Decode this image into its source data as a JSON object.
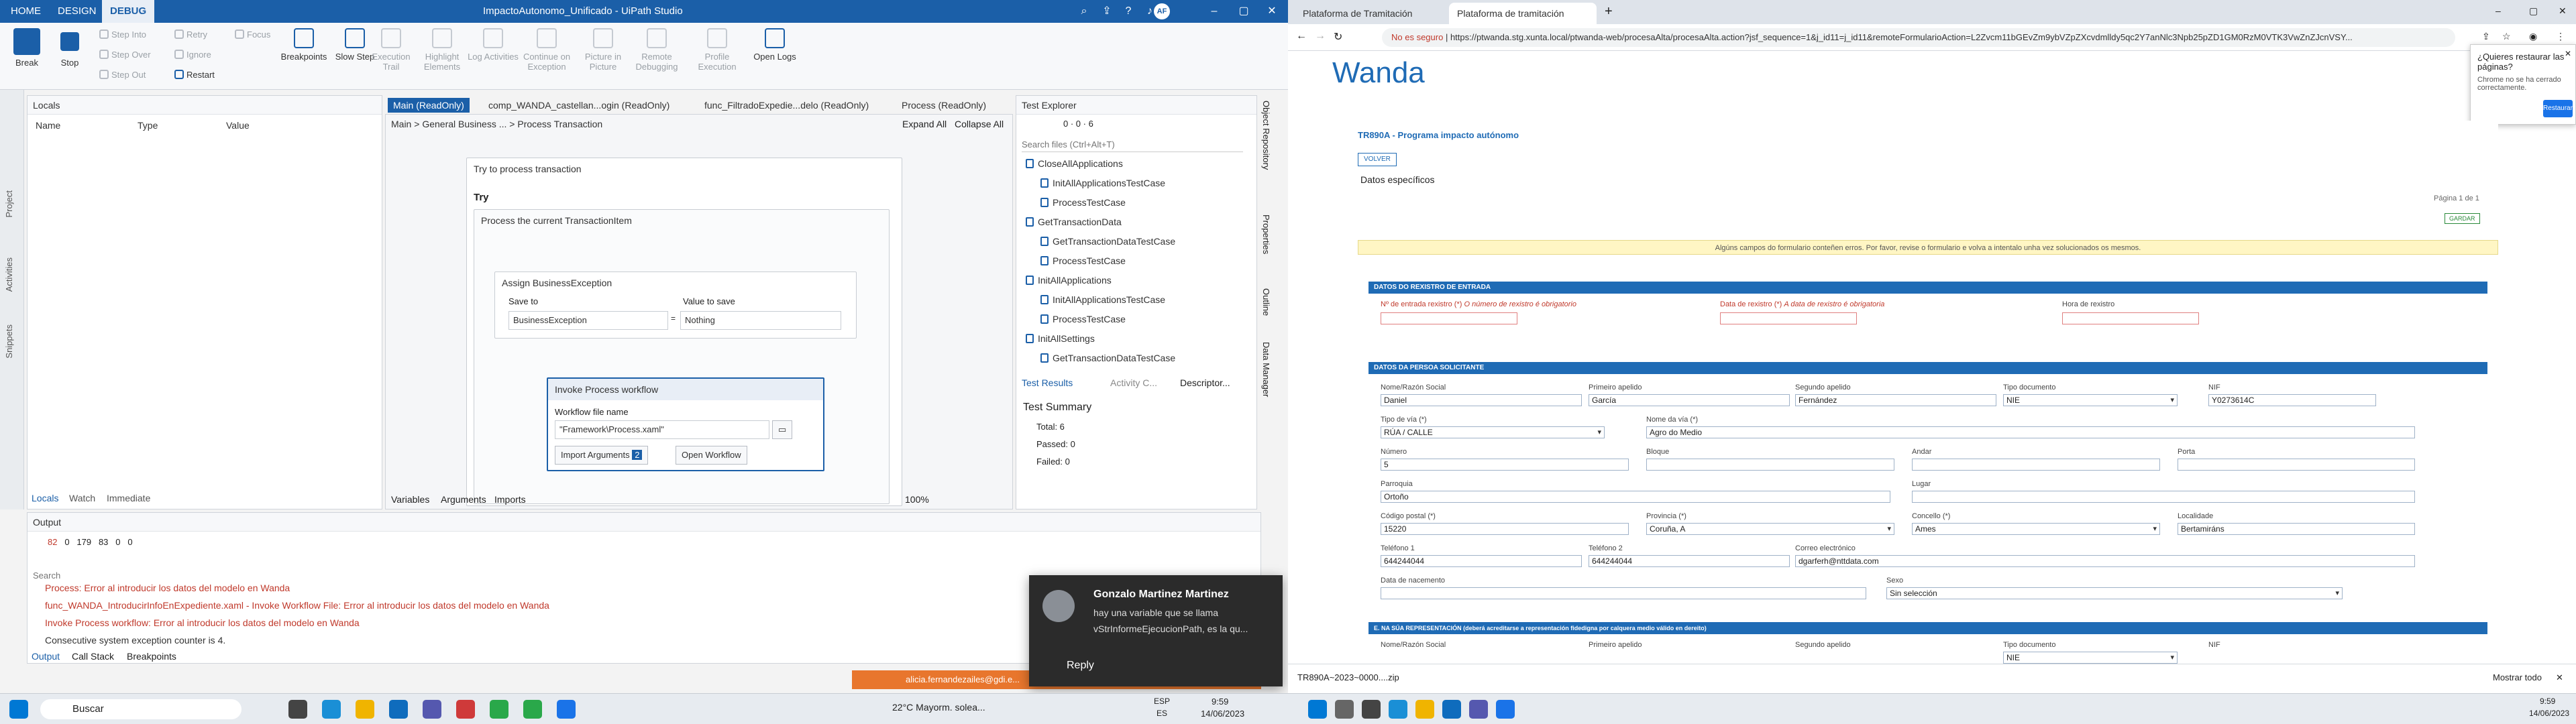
{
  "studio": {
    "tabs": [
      "HOME",
      "DESIGN",
      "DEBUG"
    ],
    "active_tab": "DEBUG",
    "title": "ImpactoAutonomo_Unificado - UiPath Studio",
    "user_initials": "AF",
    "ribbon": {
      "break": "Break",
      "stop": "Stop",
      "step_into": "Step Into",
      "step_over": "Step Over",
      "step_out": "Step Out",
      "retry": "Retry",
      "ignore": "Ignore",
      "restart": "Restart",
      "focus": "Focus",
      "breakpoints": "Breakpoints",
      "slow_step": "Slow Step",
      "execution_trail": "Execution Trail",
      "highlight_elements": "Highlight Elements",
      "log_activities": "Log Activities",
      "continue_on_exception": "Continue on Exception",
      "picture_in_picture": "Picture in Picture",
      "remote_debugging": "Remote Debugging",
      "profile_execution": "Profile Execution",
      "open_logs": "Open Logs"
    },
    "side_tabs": [
      "Project",
      "Activities",
      "Snippets"
    ],
    "locals": {
      "title": "Locals",
      "cols": [
        "Name",
        "Type",
        "Value"
      ],
      "bottom_tabs": [
        "Locals",
        "Watch",
        "Immediate"
      ]
    },
    "doc_tabs": [
      "Main (ReadOnly)",
      "comp_WANDA_castellan...ogin (ReadOnly)",
      "func_FiltradoExpedie...delo (ReadOnly)",
      "Process (ReadOnly)"
    ],
    "breadcrumb": [
      "Main",
      "General Business ...",
      "Process Transaction"
    ],
    "expand_all": "Expand All",
    "collapse_all": "Collapse All",
    "activities": {
      "try_process": "Try to process transaction",
      "try": "Try",
      "process_current": "Process the current TransactionItem",
      "assign": "Assign BusinessException",
      "save_to": "Save to",
      "value_to_save": "Value to save",
      "save_to_val": "BusinessException",
      "value_val": "Nothing",
      "invoke": "Invoke Process workflow",
      "wf_file_name": "Workflow file name",
      "wf_file_val": "\"Framework\\Process.xaml\"",
      "import_args": "Import Arguments",
      "import_count": "2",
      "open_workflow": "Open Workflow"
    },
    "designer_bottom": [
      "Variables",
      "Arguments",
      "Imports"
    ],
    "zoom": "100%",
    "test_explorer": {
      "title": "Test Explorer",
      "counts": [
        "0",
        "0",
        "6"
      ],
      "search_ph": "Search files (Ctrl+Alt+T)",
      "items": [
        {
          "label": "CloseAllApplications",
          "level": 0
        },
        {
          "label": "InitAllApplicationsTestCase",
          "level": 1
        },
        {
          "label": "ProcessTestCase",
          "level": 1
        },
        {
          "label": "GetTransactionData",
          "level": 0
        },
        {
          "label": "GetTransactionDataTestCase",
          "level": 1
        },
        {
          "label": "ProcessTestCase",
          "level": 1
        },
        {
          "label": "InitAllApplications",
          "level": 0
        },
        {
          "label": "InitAllApplicationsTestCase",
          "level": 1
        },
        {
          "label": "ProcessTestCase",
          "level": 1
        },
        {
          "label": "InitAllSettings",
          "level": 0
        },
        {
          "label": "GetTransactionDataTestCase",
          "level": 1
        }
      ],
      "bottom_tabs": [
        "Test Results",
        "Activity C...",
        "Descriptor..."
      ],
      "summary_title": "Test Summary",
      "total": "Total: 6",
      "passed": "Passed: 0",
      "failed": "Failed: 0"
    },
    "right_side_tabs": [
      "Object Repository",
      "Properties",
      "Outline",
      "Data Manager"
    ],
    "output": {
      "title": "Output",
      "counts": [
        "82",
        "0",
        "179",
        "83",
        "0",
        "0"
      ],
      "search_ph": "Search",
      "lines": [
        "Process: Error al introducir los datos del modelo en Wanda",
        "func_WANDA_IntroducirInfoEnExpediente.xaml - Invoke Workflow File: Error al introducir los datos del modelo en Wanda",
        "Invoke Process workflow: Error al introducir los datos del modelo en Wanda",
        "Consecutive system exception counter is 4."
      ],
      "bottom_tabs": [
        "Output",
        "Call Stack",
        "Breakpoints"
      ]
    },
    "status_user": "alicia.fernandezailes@gdi.e...",
    "notification": {
      "name": "Gonzalo Martinez Martinez",
      "msg1": "hay una variable que se llama",
      "msg2": "vStrInformeEjecucionPath, es la qu...",
      "reply": "Reply"
    },
    "taskbar": {
      "search": "Buscar",
      "weather": "22°C Mayorm. solea...",
      "lang1": "ESP",
      "lang2": "ES",
      "time": "9:59",
      "date": "14/06/2023"
    }
  },
  "browser": {
    "tabs": [
      "Plataforma de Tramitación",
      "Plataforma de tramitación"
    ],
    "not_secure": "No es seguro",
    "url": "https://ptwanda.stg.xunta.local/ptwanda-web/procesaAlta/procesaAlta.action?jsf_sequence=1&j_id11=j_id11&remoteFormularioAction=L2Zvcm11bGEvZm9ybVZpZXcvdmlldy5qc2Y7anNlc3Npb25pZD1GM0RzM0VTK3VwZnZJcnVSY...",
    "brand": "Wanda",
    "restore": {
      "title": "¿Quieres restaurar las páginas?",
      "msg": "Chrome no se ha cerrado correctamente.",
      "button": "Restaurar"
    },
    "form": {
      "title": "TR890A - Programa impacto autónomo",
      "back": "VOLVER",
      "section": "Datos específicos",
      "page": "Página 1 de 1",
      "save": "GARDAR",
      "warning": "Algúns campos do formulario conteñen erros. Por favor, revise o formulario e volva a intentalo unha vez solucionados os mesmos.",
      "sec1": "DATOS DO REXISTRO DE ENTRADA",
      "entry_no": "Nº de entrada rexistro (*)",
      "entry_no_err": "O número de rexistro é obrigatorio",
      "reg_date": "Data de rexistro (*)",
      "reg_date_err": "A data de rexistro é obrigatoria",
      "reg_time": "Hora de rexistro",
      "sec2": "DATOS DA PERSOA SOLICITANTE",
      "f": {
        "razon": "Nome/Razón Social",
        "apel1": "Primeiro apelido",
        "apel2": "Segundo apelido",
        "tipodoc": "Tipo documento",
        "nif": "NIF",
        "razon_v": "Daniel",
        "apel1_v": "García",
        "apel2_v": "Fernández",
        "tipodoc_v": "NIE",
        "nif_v": "Y0273614C",
        "tipovia": "Tipo de vía (*)",
        "tipovia_v": "RÚA / CALLE",
        "nomevia": "Nome da vía (*)",
        "nomevia_v": "Agro do Medio",
        "numero": "Número",
        "numero_v": "5",
        "bloque": "Bloque",
        "andar": "Andar",
        "porta": "Porta",
        "parroquia": "Parroquia",
        "parroquia_v": "Ortoño",
        "lugar": "Lugar",
        "cp": "Código postal (*)",
        "cp_v": "15220",
        "provincia": "Provincia (*)",
        "provincia_v": "Coruña, A",
        "concello": "Concello (*)",
        "concello_v": "Ames",
        "localidade": "Localidade",
        "localidade_v": "Bertamiráns",
        "tel1": "Teléfono 1",
        "tel1_v": "644244044",
        "tel2": "Teléfono 2",
        "tel2_v": "644244044",
        "email": "Correo electrónico",
        "email_v": "dgarferh@nttdata.com",
        "nacemento": "Data de nacemento",
        "sexo": "Sexo",
        "sexo_v": "Sin selección"
      },
      "sec3": "E. NA SÚA REPRESENTACIÓN (deberá acreditarse a representación fidedigna por calquera medio válido en dereito)",
      "f3": {
        "razon": "Nome/Razón Social",
        "apel1": "Primeiro apelido",
        "apel2": "Segundo apelido",
        "tipodoc": "Tipo documento",
        "tipodoc_v": "NIE",
        "nif": "NIF"
      }
    },
    "download": "TR890A~2023~0000....zip",
    "show_all": "Mostrar todo",
    "time": "9:59",
    "date": "14/06/2023"
  }
}
